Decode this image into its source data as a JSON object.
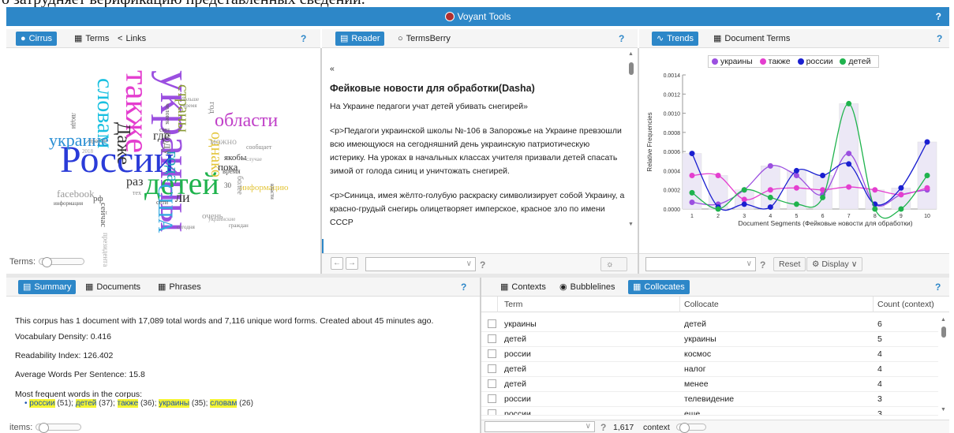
{
  "doc_strip_text": "о затрудняет верификацию представленных сведений.",
  "app": {
    "title": "Voyant Tools",
    "help": "?"
  },
  "cirrus_panel": {
    "tabs": [
      {
        "label": "Cirrus",
        "icon": "cloud-icon"
      },
      {
        "label": "Terms",
        "icon": "grid-icon"
      },
      {
        "label": "Links",
        "icon": "share-icon"
      }
    ],
    "help": "?",
    "slider_label": "Terms:",
    "words": [
      {
        "text": "украины",
        "size": 56,
        "color": "#9b4fe0",
        "rotate": 90
      },
      {
        "text": "также",
        "size": 42,
        "color": "#e43ecf",
        "rotate": 90
      },
      {
        "text": "словам",
        "size": 30,
        "color": "#19c0e0",
        "rotate": 90
      },
      {
        "text": "России",
        "size": 48,
        "color": "#2a3bd8",
        "rotate": 0
      },
      {
        "text": "детей",
        "size": 40,
        "color": "#1fb34d",
        "rotate": 0
      },
      {
        "text": "области",
        "size": 24,
        "color": "#c040c8",
        "rotate": 0
      },
      {
        "text": "украине",
        "size": 22,
        "color": "#2a8fd4",
        "rotate": 0
      },
      {
        "text": "США",
        "size": 26,
        "color": "#33a8e0",
        "rotate": 90
      },
      {
        "text": "года",
        "size": 22,
        "color": "#1fa0b8",
        "rotate": 90
      },
      {
        "text": "Даже",
        "size": 24,
        "color": "#333333",
        "rotate": 90
      },
      {
        "text": "страны",
        "size": 20,
        "color": "#889933",
        "rotate": 90
      },
      {
        "text": "однако",
        "size": 20,
        "color": "#e3c53a",
        "rotate": 90
      },
      {
        "text": "году",
        "size": 16,
        "color": "#777777",
        "rotate": 90
      },
      {
        "text": "где",
        "size": 16,
        "color": "#333333",
        "rotate": 0
      },
      {
        "text": "раз",
        "size": 16,
        "color": "#333333",
        "rotate": 0
      },
      {
        "text": "ли",
        "size": 18,
        "color": "#333333",
        "rotate": 0
      },
      {
        "text": "пока",
        "size": 13,
        "color": "#333333",
        "rotate": 0
      },
      {
        "text": "якобы",
        "size": 11,
        "color": "#333333",
        "rotate": 0
      },
      {
        "text": "facebook",
        "size": 13,
        "color": "#999999",
        "rotate": 0
      },
      {
        "text": "информацию",
        "size": 11,
        "color": "#e3c53a",
        "rotate": 0
      },
      {
        "text": "очень",
        "size": 11,
        "color": "#999999",
        "rotate": 0
      },
      {
        "text": "можно",
        "size": 12,
        "color": "#aaaaaa",
        "rotate": 0
      },
      {
        "text": "время",
        "size": 9,
        "color": "#555555",
        "rotate": 0
      },
      {
        "text": "сообщает",
        "size": 8,
        "color": "#888888",
        "rotate": 0
      },
      {
        "text": "сейчас",
        "size": 11,
        "color": "#555555",
        "rotate": 90
      },
      {
        "text": "рф",
        "size": 11,
        "color": "#555555",
        "rotate": 0
      },
      {
        "text": "сети",
        "size": 8,
        "color": "#555555",
        "rotate": 0
      },
      {
        "text": "просто",
        "size": 8,
        "color": "#888888",
        "rotate": 0
      },
      {
        "text": "люди",
        "size": 9,
        "color": "#666666",
        "rotate": 90
      },
      {
        "text": "больше",
        "size": 7,
        "color": "#888888",
        "rotate": 0
      },
      {
        "text": "время",
        "size": 7,
        "color": "#888888",
        "rotate": 0
      },
      {
        "text": "власти",
        "size": 7,
        "color": "#555555",
        "rotate": 90
      },
      {
        "text": "информация",
        "size": 7,
        "color": "#555555",
        "rotate": 0
      },
      {
        "text": "граждан",
        "size": 7,
        "color": "#777777",
        "rotate": 0
      },
      {
        "text": "сегодня",
        "size": 7,
        "color": "#777777",
        "rotate": 0
      },
      {
        "text": "президента",
        "size": 9,
        "color": "#aaaaaa",
        "rotate": 90
      },
      {
        "text": "год",
        "size": 11,
        "color": "#888888",
        "rotate": 90
      },
      {
        "text": "смн",
        "size": 8,
        "color": "#555555",
        "rotate": 0
      },
      {
        "text": "30",
        "size": 9,
        "color": "#555555",
        "rotate": 0
      },
      {
        "text": "человек",
        "size": 8,
        "color": "#555555",
        "rotate": 90
      },
      {
        "text": "более",
        "size": 10,
        "color": "#888888",
        "rotate": 90
      },
      {
        "text": "тех",
        "size": 8,
        "color": "#888888",
        "rotate": 0
      },
      {
        "text": "2018",
        "size": 7,
        "color": "#999999",
        "rotate": 0
      },
      {
        "text": "случае",
        "size": 7,
        "color": "#999999",
        "rotate": 0
      },
      {
        "text": "украинские",
        "size": 7,
        "color": "#999999",
        "rotate": 0
      }
    ]
  },
  "reader_panel": {
    "tabs": [
      {
        "label": "Reader",
        "icon": "document-icon"
      },
      {
        "label": "TermsBerry",
        "icon": "circle-icon"
      }
    ],
    "help": "?",
    "quote_mark": "«",
    "heading": "Фейковые новости для обработки(Dasha)",
    "paragraphs": [
      "На Украине педагоги учат детей убивать снегирей»",
      "<p>Педагоги украинской школы №-106 в Запорожье на Украине превзошли всю имеющуюся на сегодняшний день украинскую патриотическую истерику. На уроках в начальных классах учителя призвали детей спасать зимой от голода синиц и уничтожать снегирей.",
      "<p>Синица, имея жёлто-голубую раскраску символизирует собой Украину, а красно-грудый снегирь олицетворяет имперское, красное зло по имени СССР"
    ],
    "help_bottom": "?"
  },
  "trends_panel": {
    "tabs": [
      {
        "label": "Trends",
        "icon": "chart-icon"
      },
      {
        "label": "Document Terms",
        "icon": "grid-icon"
      }
    ],
    "help": "?",
    "reset_label": "Reset",
    "display_label": "Display",
    "help_bottom": "?"
  },
  "chart_data": {
    "type": "line",
    "x": [
      1,
      2,
      3,
      4,
      5,
      6,
      7,
      8,
      9,
      10
    ],
    "xlabel": "Document Segments (Фейковые новости для обработки)",
    "ylabel": "Relative Frequencies",
    "ylim": [
      0,
      0.0014
    ],
    "yticks": [
      "0.0000",
      "0.0002",
      "0.0004",
      "0.0006",
      "0.0008",
      "0.0010",
      "0.0012",
      "0.0014"
    ],
    "legend_position": "top",
    "series": [
      {
        "name": "украины",
        "color": "#9b4fe0",
        "values": [
          7e-05,
          5e-05,
          0.0002,
          0.00045,
          0.00035,
          0.00015,
          0.00058,
          5e-05,
          0.00015,
          0.0002
        ]
      },
      {
        "name": "также",
        "color": "#e43ecf",
        "values": [
          0.00035,
          0.00035,
          0.0001,
          0.0002,
          0.00022,
          0.0002,
          0.00023,
          0.0002,
          0.00015,
          0.00022
        ]
      },
      {
        "name": "россии",
        "color": "#1a1fd0",
        "values": [
          0.00058,
          2e-05,
          5e-05,
          2e-05,
          0.0004,
          0.00035,
          0.00047,
          5e-05,
          0.00022,
          0.0007
        ]
      },
      {
        "name": "детей",
        "color": "#1fb34d",
        "values": [
          0.00017,
          0.0,
          0.0002,
          0.00012,
          5e-05,
          0.00012,
          0.0011,
          0.0,
          0.0,
          0.00035
        ]
      }
    ]
  },
  "summary_panel": {
    "tabs": [
      {
        "label": "Summary",
        "icon": "summary-icon"
      },
      {
        "label": "Documents",
        "icon": "grid-icon"
      },
      {
        "label": "Phrases",
        "icon": "grid-icon"
      }
    ],
    "help": "?",
    "line1": "This corpus has 1 document with 17,089 total words and 7,116 unique word forms. Created about 45 minutes ago.",
    "vocab": "Vocabulary Density: 0.416",
    "readability": "Readability Index: 126.402",
    "avg_words": "Average Words Per Sentence: 15.8",
    "most_frequent_label": "Most frequent words in the corpus:",
    "frequent_words": [
      {
        "word": "россии",
        "count": "(51);"
      },
      {
        "word": "детей",
        "count": "(37);"
      },
      {
        "word": "также",
        "count": "(36);"
      },
      {
        "word": "украины",
        "count": "(35);"
      },
      {
        "word": "словам",
        "count": "(26)"
      }
    ],
    "slider_label": "items:"
  },
  "collocates_panel": {
    "tabs": [
      {
        "label": "Contexts",
        "icon": "grid-icon"
      },
      {
        "label": "Bubblelines",
        "icon": "eye-icon"
      },
      {
        "label": "Collocates",
        "icon": "grid-icon"
      }
    ],
    "help": "?",
    "columns": [
      "Term",
      "Collocate",
      "Count (context)"
    ],
    "rows": [
      {
        "term": "украины",
        "collocate": "детей",
        "count": "6"
      },
      {
        "term": "детей",
        "collocate": "украины",
        "count": "5"
      },
      {
        "term": "россии",
        "collocate": "космос",
        "count": "4"
      },
      {
        "term": "детей",
        "collocate": "налог",
        "count": "4"
      },
      {
        "term": "детей",
        "collocate": "менее",
        "count": "4"
      },
      {
        "term": "россии",
        "collocate": "телевидение",
        "count": "3"
      },
      {
        "term": "россии",
        "collocate": "еще",
        "count": "3"
      }
    ],
    "context_value": "1,617",
    "context_label": "context",
    "help_bottom": "?"
  }
}
